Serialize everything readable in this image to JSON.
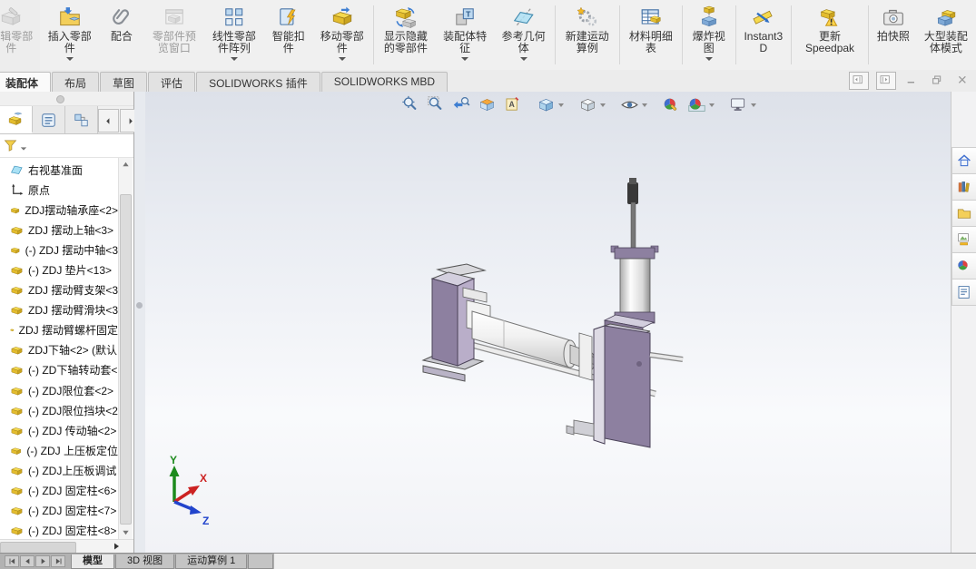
{
  "ribbon": {
    "buttons": [
      {
        "label": "编辑零部件",
        "icon": "edit-component-icon",
        "disabled": true,
        "dropdown": false,
        "sep_after": false
      },
      {
        "label": "插入零部件",
        "icon": "insert-component-icon",
        "disabled": false,
        "dropdown": true,
        "sep_after": false
      },
      {
        "label": "配合",
        "icon": "mate-icon",
        "disabled": false,
        "dropdown": false,
        "sep_after": false
      },
      {
        "label": "零部件预览窗口",
        "icon": "component-preview-icon",
        "disabled": true,
        "dropdown": false,
        "sep_after": false
      },
      {
        "label": "线性零部件阵列",
        "icon": "linear-pattern-icon",
        "disabled": false,
        "dropdown": true,
        "sep_after": false
      },
      {
        "label": "智能扣件",
        "icon": "smart-fastener-icon",
        "disabled": false,
        "dropdown": false,
        "sep_after": false
      },
      {
        "label": "移动零部件",
        "icon": "move-component-icon",
        "disabled": false,
        "dropdown": true,
        "sep_after": true
      },
      {
        "label": "显示隐藏的零部件",
        "icon": "show-hidden-icon",
        "disabled": false,
        "dropdown": false,
        "sep_after": false
      },
      {
        "label": "装配体特征",
        "icon": "assembly-feature-icon",
        "disabled": false,
        "dropdown": true,
        "sep_after": false
      },
      {
        "label": "参考几何体",
        "icon": "reference-geometry-icon",
        "disabled": false,
        "dropdown": true,
        "sep_after": true
      },
      {
        "label": "新建运动算例",
        "icon": "motion-study-icon",
        "disabled": false,
        "dropdown": false,
        "sep_after": true
      },
      {
        "label": "材料明细表",
        "icon": "bom-icon",
        "disabled": false,
        "dropdown": false,
        "sep_after": true
      },
      {
        "label": "爆炸视图",
        "icon": "exploded-view-icon",
        "disabled": false,
        "dropdown": true,
        "sep_after": true
      },
      {
        "label": "Instant3D",
        "icon": "instant3d-icon",
        "disabled": false,
        "dropdown": false,
        "sep_after": true
      },
      {
        "label": "更新 Speedpak",
        "icon": "speedpak-icon",
        "disabled": false,
        "dropdown": false,
        "sep_after": true
      },
      {
        "label": "拍快照",
        "icon": "snapshot-icon",
        "disabled": false,
        "dropdown": false,
        "sep_after": false
      },
      {
        "label": "大型装配体模式",
        "icon": "large-assembly-icon",
        "disabled": false,
        "dropdown": false,
        "sep_after": false
      }
    ]
  },
  "command_tabs": {
    "tabs": [
      {
        "label": "装配体",
        "active": true
      },
      {
        "label": "布局",
        "active": false
      },
      {
        "label": "草图",
        "active": false
      },
      {
        "label": "评估",
        "active": false
      },
      {
        "label": "SOLIDWORKS 插件",
        "active": false
      },
      {
        "label": "SOLIDWORKS MBD",
        "active": false
      }
    ],
    "window_controls": [
      {
        "icon": "pane-previous-icon",
        "boxed": true
      },
      {
        "icon": "pane-next-icon",
        "boxed": true
      },
      {
        "icon": "minimize-icon",
        "boxed": false
      },
      {
        "icon": "restore-icon",
        "boxed": false
      },
      {
        "icon": "close-icon",
        "boxed": false
      }
    ]
  },
  "feature_panel": {
    "header_tabs": [
      {
        "icon": "featuremanager-tree-icon",
        "active": true
      },
      {
        "icon": "propertymanager-icon",
        "active": false
      },
      {
        "icon": "configurationmanager-icon",
        "active": false
      }
    ],
    "scroll_arrows": [
      {
        "icon": "tab-scroll-left-icon"
      },
      {
        "icon": "tab-scroll-right-icon"
      }
    ],
    "filter": {
      "icon": "filter-funnel-icon"
    },
    "tree": [
      {
        "icon": "plane-icon",
        "label": "右视基准面"
      },
      {
        "icon": "origin-icon",
        "label": "原点"
      },
      {
        "icon": "component-icon",
        "label": "ZDJ摆动轴承座<2>"
      },
      {
        "icon": "component-icon",
        "label": "ZDJ 摆动上轴<3>"
      },
      {
        "icon": "component-icon",
        "label": "(-) ZDJ 摆动中轴<3"
      },
      {
        "icon": "component-icon",
        "label": "(-) ZDJ 垫片<13>"
      },
      {
        "icon": "component-icon",
        "label": "ZDJ 摆动臂支架<3"
      },
      {
        "icon": "component-icon",
        "label": "ZDJ 摆动臂滑块<3"
      },
      {
        "icon": "component-icon",
        "label": "ZDJ 摆动臂螺杆固定"
      },
      {
        "icon": "component-icon",
        "label": "ZDJ下轴<2> (默认"
      },
      {
        "icon": "component-icon",
        "label": "(-) ZD下轴转动套<"
      },
      {
        "icon": "component-icon",
        "label": "(-) ZDJ限位套<2>"
      },
      {
        "icon": "component-icon",
        "label": "(-) ZDJ限位挡块<2"
      },
      {
        "icon": "component-icon",
        "label": "(-) ZDJ 传动轴<2>"
      },
      {
        "icon": "component-icon",
        "label": "(-) ZDJ 上压板定位"
      },
      {
        "icon": "component-icon",
        "label": "(-) ZDJ上压板调试"
      },
      {
        "icon": "component-icon",
        "label": "(-) ZDJ 固定柱<6>"
      },
      {
        "icon": "component-icon",
        "label": "(-) ZDJ 固定柱<7>"
      },
      {
        "icon": "component-icon",
        "label": "(-) ZDJ 固定柱<8>"
      }
    ]
  },
  "viewport": {
    "headsup": [
      {
        "icon": "zoom-to-fit-icon",
        "dropdown": false,
        "gap_after": false
      },
      {
        "icon": "zoom-to-area-icon",
        "dropdown": false,
        "gap_after": false
      },
      {
        "icon": "previous-view-icon",
        "dropdown": false,
        "gap_after": false
      },
      {
        "icon": "section-view-icon",
        "dropdown": false,
        "gap_after": false
      },
      {
        "icon": "annotation-visibility-icon",
        "dropdown": false,
        "gap_after": true
      },
      {
        "icon": "view-orientation-icon",
        "dropdown": true,
        "gap_after": true
      },
      {
        "icon": "display-style-icon",
        "dropdown": true,
        "gap_after": true
      },
      {
        "icon": "hide-show-items-icon",
        "dropdown": true,
        "gap_after": true
      },
      {
        "icon": "edit-appearance-icon",
        "dropdown": false,
        "gap_after": false
      },
      {
        "icon": "apply-scene-icon",
        "dropdown": true,
        "gap_after": true
      },
      {
        "icon": "view-settings-icon",
        "dropdown": true,
        "gap_after": false
      }
    ],
    "triad": {
      "x_label": "X",
      "y_label": "Y",
      "z_label": "Z",
      "x_color": "#cc2222",
      "y_color": "#1d8a1d",
      "z_color": "#2244cc"
    },
    "model_colors": {
      "bracket_purple": "#8d80a0",
      "bracket_light": "#b9aec9",
      "top_light": "#d3cfde",
      "cylinder_white": "#f4f4f6",
      "rod_dark": "#5a5a5a",
      "background_top": "#dde1e9",
      "background_bottom": "#f1f2f6"
    }
  },
  "task_pane": {
    "icons": [
      {
        "icon": "home-icon"
      },
      {
        "icon": "design-library-icon"
      },
      {
        "icon": "file-explorer-icon"
      },
      {
        "icon": "view-palette-icon"
      },
      {
        "icon": "appearances-scenes-icon"
      },
      {
        "icon": "custom-properties-icon"
      }
    ]
  },
  "bottom_bar": {
    "nav": [
      {
        "icon": "go-first-icon"
      },
      {
        "icon": "go-previous-icon"
      },
      {
        "icon": "go-next-icon"
      },
      {
        "icon": "go-last-icon"
      }
    ],
    "tabs": [
      {
        "label": "模型",
        "active": true
      },
      {
        "label": "3D 视图",
        "active": false
      },
      {
        "label": "运动算例 1",
        "active": false
      }
    ]
  }
}
